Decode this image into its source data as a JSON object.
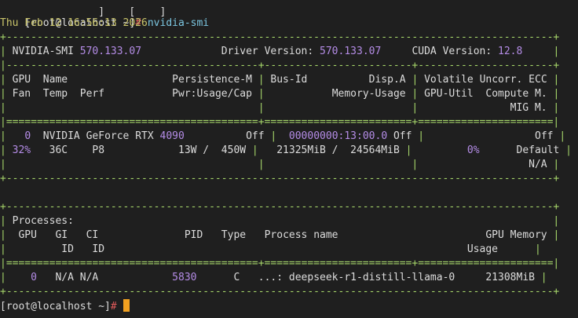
{
  "terminal": {
    "prompt": "[root@localhost ~]",
    "prompt_symbol": "#",
    "command": " nvidia-smi",
    "top_fragment": "            ]    [    ]",
    "timestamp": "Thu Feb 12 16:56:13 2026",
    "colors": {
      "background": "#1f1f1f",
      "text": "#dcdcdc",
      "prompt_symbol": "#e05a5a",
      "border": "#a6d66a",
      "number": "#b48ce6",
      "timestamp": "#c9c46a",
      "command": "#7cc6e0",
      "cursor": "#f0a020"
    }
  },
  "smi": {
    "border_top": "+-----------------------------------------------------------------------------------------+",
    "header": {
      "label_smi": "NVIDIA-SMI",
      "smi_version": "570.133.07",
      "label_driver": "Driver Version:",
      "driver_version": "570.133.07",
      "label_cuda": "CUDA Version:",
      "cuda_version": "12.8"
    },
    "sep_dash": "|-----------------------------------------+------------------------+----------------------+",
    "col_headers": {
      "row1": [
        "GPU",
        "Name",
        "Persistence-M",
        "Bus-Id",
        "Disp.A",
        "Volatile",
        "Uncorr. ECC"
      ],
      "row2": [
        "Fan",
        "Temp",
        "Perf",
        "Pwr:Usage/Cap",
        "Memory-Usage",
        "GPU-Util",
        "Compute M."
      ],
      "row3": [
        "MIG M."
      ]
    },
    "sep_eq": "|=========================================+========================+======================|",
    "gpu": {
      "index": "0",
      "name": "NVIDIA GeForce RTX",
      "model": "4090",
      "persistence": "Off",
      "bus_id": "00000000",
      "bus_rest": ":13:00.0",
      "disp": "Off",
      "ecc": "Off",
      "fan": "32%",
      "temp": "36C",
      "perf": "P8",
      "power": "13W /  450W",
      "memory_used": "21325MiB",
      "memory_total": "24564MiB",
      "util": "0%",
      "compute_mode": "Default",
      "mig": "N/A"
    },
    "processes": {
      "title": "Processes:",
      "headers": [
        "GPU",
        "GI",
        "CI",
        "PID",
        "Type",
        "Process name",
        "GPU Memory"
      ],
      "headers2": [
        "ID",
        "ID",
        "Usage"
      ],
      "rows": [
        {
          "gpu": "0",
          "gi": "N/A",
          "ci": "N/A",
          "pid": "5830",
          "type": "C",
          "name": "...: deepseek-r1-distill-llama-0",
          "mem": "21308MiB"
        }
      ]
    }
  }
}
